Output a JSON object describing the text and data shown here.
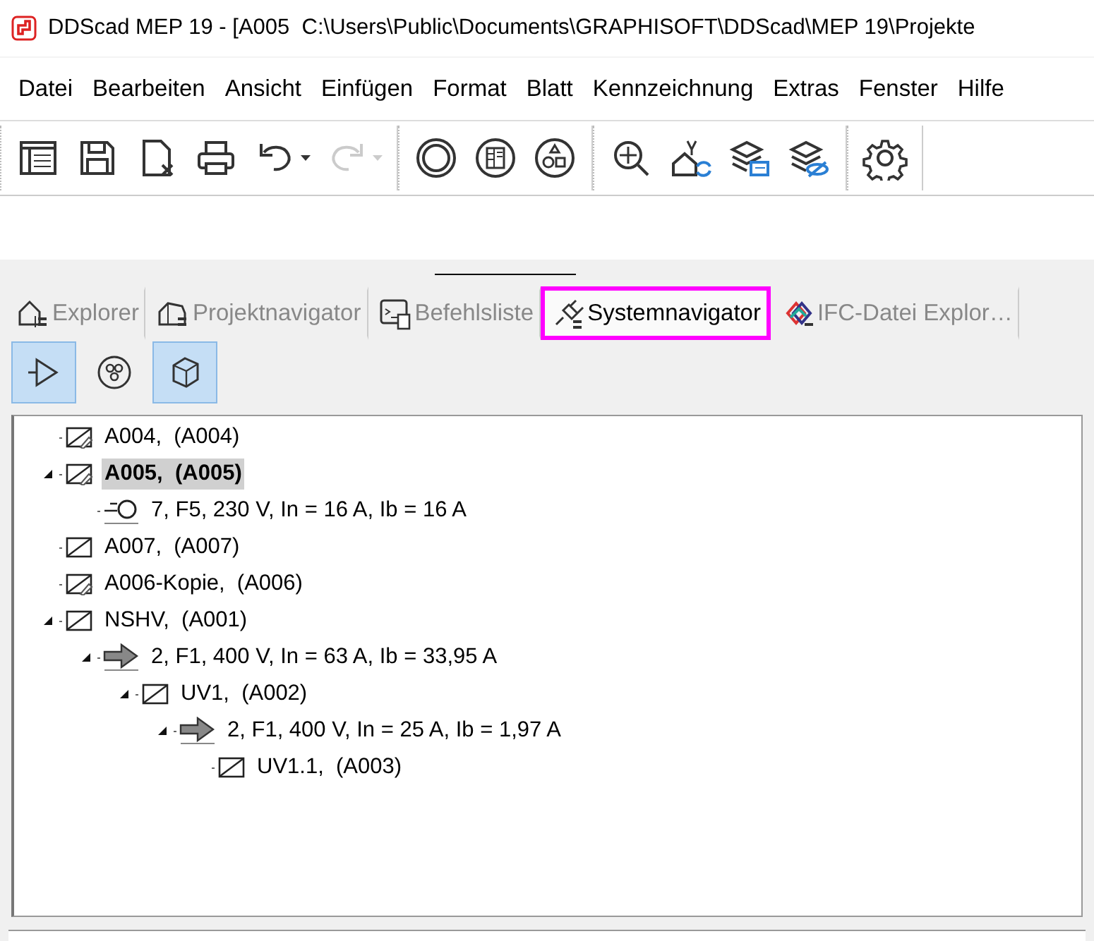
{
  "window": {
    "title": "DDScad MEP 19 - [A005  C:\\Users\\Public\\Documents\\GRAPHISOFT\\DDScad\\MEP 19\\Projekte"
  },
  "menu": [
    "Datei",
    "Bearbeiten",
    "Ansicht",
    "Einfügen",
    "Format",
    "Blatt",
    "Kennzeichnung",
    "Extras",
    "Fenster",
    "Hilfe"
  ],
  "toolbar": [
    [
      {
        "disabled": false,
        "dropdown": false
      },
      {
        "disabled": false,
        "dropdown": false
      },
      {
        "disabled": false,
        "dropdown": false
      },
      {
        "disabled": false,
        "dropdown": false
      },
      {
        "disabled": false,
        "dropdown": true
      },
      {
        "disabled": true,
        "dropdown": true
      }
    ],
    [
      {
        "disabled": false,
        "dropdown": false
      },
      {
        "disabled": false,
        "dropdown": false
      },
      {
        "disabled": false,
        "dropdown": false
      }
    ],
    [
      {
        "disabled": false,
        "dropdown": false
      },
      {
        "disabled": false,
        "dropdown": false
      },
      {
        "disabled": false,
        "dropdown": false
      },
      {
        "disabled": false,
        "dropdown": false
      }
    ],
    [
      {
        "disabled": false,
        "dropdown": false
      }
    ]
  ],
  "tabs": [
    {
      "label": "Explorer",
      "selected": false,
      "highlighted": false
    },
    {
      "label": "Projektnavigator",
      "selected": false,
      "highlighted": false
    },
    {
      "label": "Befehlsliste",
      "selected": false,
      "highlighted": false
    },
    {
      "label": "Systemnavigator",
      "selected": true,
      "highlighted": true
    },
    {
      "label": "IFC-Datei Explor…",
      "selected": false,
      "highlighted": false
    }
  ],
  "view_buttons": [
    {
      "selected": true
    },
    {
      "selected": false
    },
    {
      "selected": true
    }
  ],
  "tree": [
    {
      "label": "A004,  (A004)",
      "kind": "linked-distributor",
      "selected": false
    },
    {
      "label": "A005,  (A005)",
      "kind": "linked-distributor",
      "selected": true,
      "expanded": true,
      "children": [
        {
          "label": "7, F5, 230 V, In = 16 A, Ib = 16 A",
          "kind": "socket-circuit",
          "selected": false
        }
      ]
    },
    {
      "label": "A007,  (A007)",
      "kind": "distributor",
      "selected": false
    },
    {
      "label": "A006-Kopie,  (A006)",
      "kind": "linked-distributor",
      "selected": false
    },
    {
      "label": "NSHV,  (A001)",
      "kind": "distributor",
      "selected": false,
      "expanded": true,
      "children": [
        {
          "label": "2, F1, 400 V, In = 63 A, Ib = 33,95 A",
          "kind": "feed-circuit",
          "selected": false,
          "expanded": true,
          "children": [
            {
              "label": "UV1,  (A002)",
              "kind": "distributor",
              "selected": false,
              "expanded": true,
              "children": [
                {
                  "label": "2, F1, 400 V, In = 25 A, Ib = 1,97 A",
                  "kind": "feed-circuit",
                  "selected": false,
                  "expanded": true,
                  "children": [
                    {
                      "label": "UV1.1,  (A003)",
                      "kind": "distributor",
                      "selected": false
                    }
                  ]
                }
              ]
            }
          ]
        }
      ]
    }
  ]
}
